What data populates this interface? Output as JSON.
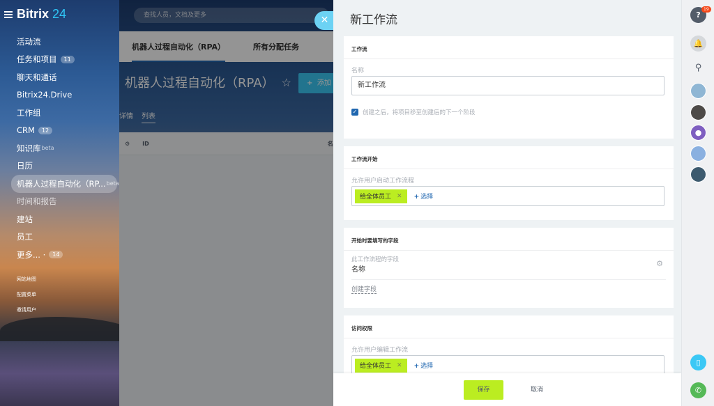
{
  "brand": {
    "name": "Bitrix",
    "number": "24"
  },
  "search": {
    "placeholder": "查找人员，文档及更多"
  },
  "menu": {
    "items": [
      {
        "label": "活动流"
      },
      {
        "label": "任务和项目",
        "badge": "11"
      },
      {
        "label": "聊天和通话"
      },
      {
        "label": "Bitrix24.Drive"
      },
      {
        "label": "工作组"
      },
      {
        "label": "CRM",
        "badge": "12"
      },
      {
        "label": "知识库",
        "sup": "beta"
      },
      {
        "label": "日历"
      },
      {
        "label": "机器人过程自动化（RP...",
        "sup": "beta"
      },
      {
        "label": "时间和报告"
      },
      {
        "label": "建站"
      },
      {
        "label": "员工"
      },
      {
        "label": "更多... ·",
        "badge": "14"
      }
    ],
    "small_links": [
      "网站地图",
      "配置菜单",
      "邀请用户"
    ]
  },
  "workarea": {
    "tabs": [
      "机器人过程自动化（RPA）",
      "所有分配任务"
    ],
    "title": "机器人过程自动化（RPA）",
    "add_label": "添加",
    "subtabs": [
      "详情",
      "列表"
    ],
    "grid_columns": [
      "ID",
      "名"
    ]
  },
  "panel": {
    "title": "新工作流",
    "sections": {
      "workflow": {
        "title": "工作流",
        "name_label": "名称",
        "name_value": "新工作流",
        "checkbox_checked": true,
        "checkbox_label": "创建之后，将项目移至创建后的下一个阶段"
      },
      "start": {
        "title": "工作流开始",
        "label": "允许用户启动工作流程",
        "chip": "给全体员工",
        "choose": "选择"
      },
      "fields": {
        "title": "开始时要填写的字段",
        "label": "此工作流程的字段",
        "field_name": "名称",
        "create_label": "创建字段"
      },
      "access": {
        "title": "访问权限",
        "label": "允许用户编辑工作流",
        "chip": "给全体员工",
        "choose": "选择"
      }
    },
    "footer": {
      "save": "保存",
      "cancel": "取消"
    }
  },
  "rightbar": {
    "help_badge": "19"
  },
  "colors": {
    "accent": "#2067b0",
    "save_green": "#bbed21",
    "close_blue": "#6cd2f4",
    "call_green": "#55b957"
  }
}
